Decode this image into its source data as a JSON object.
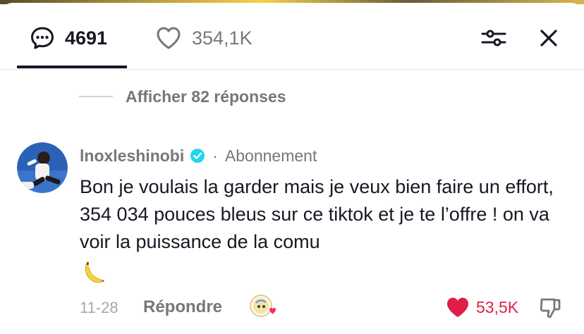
{
  "header": {
    "comments_count": "4691",
    "likes_count": "354,1K",
    "icons": {
      "comments": "comment-bubble-icon",
      "likes": "heart-outline-icon",
      "filter": "sliders-icon",
      "close": "close-icon"
    }
  },
  "replies_toggle": {
    "label": "Afficher 82 réponses"
  },
  "comment": {
    "username": "lnoxleshinobi",
    "separator": "·",
    "follow_label": "Abonnement",
    "text": "Bon je voulais la garder mais je veux bien faire un effort, 354 034 pouces bleus sur ce tiktok et je te l’offre ! on va voir la puissance de la comu",
    "date": "11-28",
    "reply_label": "Répondre",
    "like_count": "53,5K"
  },
  "colors": {
    "text_primary": "#161823",
    "text_secondary": "#75777c",
    "like_red": "#e11e48",
    "verified_blue": "#20d5ec"
  }
}
